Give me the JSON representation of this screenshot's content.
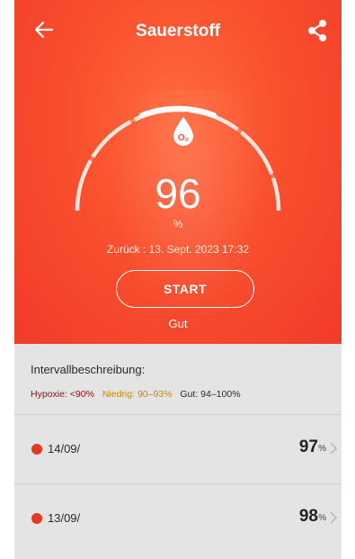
{
  "header": {
    "title": "Sauerstoff"
  },
  "measurement": {
    "value": "96",
    "unit": "%",
    "last_label": "Zurück : 13. Sept. 2023 17:32",
    "start_label": "START",
    "status": "Gut"
  },
  "interval": {
    "title": "Intervallbeschreibung:",
    "legend": {
      "hypoxie": "Hypoxie: <90%",
      "low": "Niedrig: 90–93%",
      "good": "Gut: 94–100%"
    }
  },
  "history": [
    {
      "date": "14/09/",
      "value": "97",
      "unit": "%"
    },
    {
      "date": "13/09/",
      "value": "98",
      "unit": "%"
    }
  ],
  "icons": {
    "back": "arrow-left-icon",
    "share": "share-icon",
    "o2": "o2-drop-icon",
    "chevron": "chevron-right-icon"
  },
  "colors": {
    "accent": "#f9502e",
    "status_dot": "#e3391f",
    "hypoxie": "#8a1010",
    "low": "#c48a10"
  }
}
